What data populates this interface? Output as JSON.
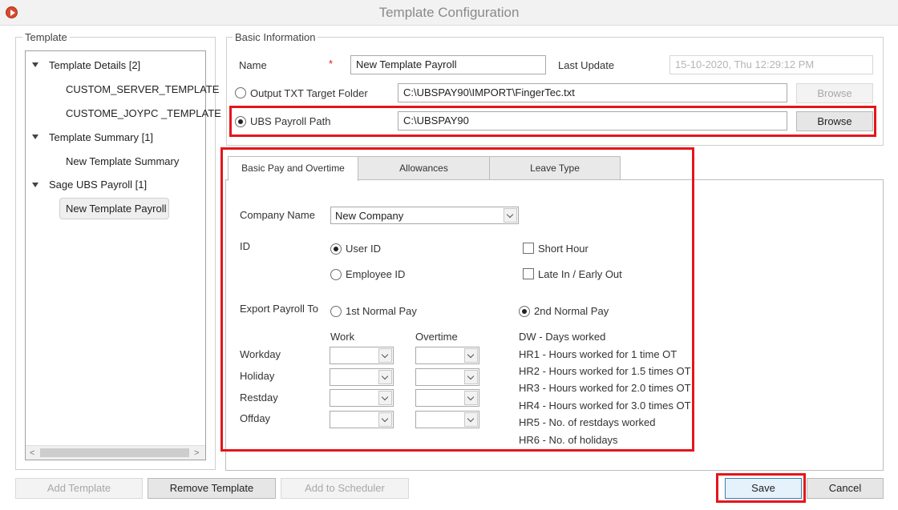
{
  "window": {
    "title": "Template Configuration"
  },
  "template_panel": {
    "title": "Template",
    "tree": [
      {
        "label": "Template Details [2]",
        "children": [
          "CUSTOM_SERVER_TEMPLATE",
          "CUSTOME_JOYPC _TEMPLATE"
        ]
      },
      {
        "label": "Template Summary [1]",
        "children": [
          "New Template Summary"
        ]
      },
      {
        "label": "Sage UBS Payroll [1]",
        "children": [
          "New Template Payroll"
        ]
      }
    ],
    "scroll_left": "<",
    "scroll_right": ">"
  },
  "basic_info": {
    "title": "Basic Information",
    "name_label": "Name",
    "required_mark": "*",
    "name_value": "New Template Payroll",
    "last_update_label": "Last Update",
    "last_update_value": "15-10-2020, Thu  12:29:12 PM",
    "output_txt_label": "Output TXT Target Folder",
    "output_txt_value": "C:\\UBSPAY90\\IMPORT\\FingerTec.txt",
    "output_browse": "Browse",
    "ubs_path_label": "UBS Payroll Path",
    "ubs_path_value": "C:\\UBSPAY90",
    "ubs_browse": "Browse"
  },
  "tabs": [
    {
      "label": "Basic Pay and Overtime",
      "active": true
    },
    {
      "label": "Allowances",
      "active": false
    },
    {
      "label": "Leave Type",
      "active": false
    }
  ],
  "basic_pay": {
    "company_label": "Company Name",
    "company_value": "New Company",
    "id_label": "ID",
    "user_id": "User ID",
    "employee_id": "Employee ID",
    "short_hour": "Short Hour",
    "late_in": "Late In / Early Out",
    "export_label": "Export Payroll To",
    "normal_pay_1": "1st Normal Pay",
    "normal_pay_2": "2nd Normal Pay",
    "work_header": "Work",
    "overtime_header": "Overtime",
    "rows": [
      "Workday",
      "Holiday",
      "Restday",
      "Offday"
    ],
    "legend": [
      "DW - Days worked",
      "HR1 - Hours worked for 1 time OT",
      "HR2 - Hours worked for 1.5 times OT",
      "HR3 - Hours worked for 2.0 times OT",
      "HR4 - Hours worked for 3.0 times OT",
      "HR5 - No. of restdays worked",
      "HR6 - No. of holidays"
    ]
  },
  "footer": {
    "add_template": "Add Template",
    "remove_template": "Remove Template",
    "add_scheduler": "Add to Scheduler",
    "save": "Save",
    "cancel": "Cancel"
  },
  "colors": {
    "highlight": "#e3161b",
    "app_icon": "#d84a2b"
  }
}
